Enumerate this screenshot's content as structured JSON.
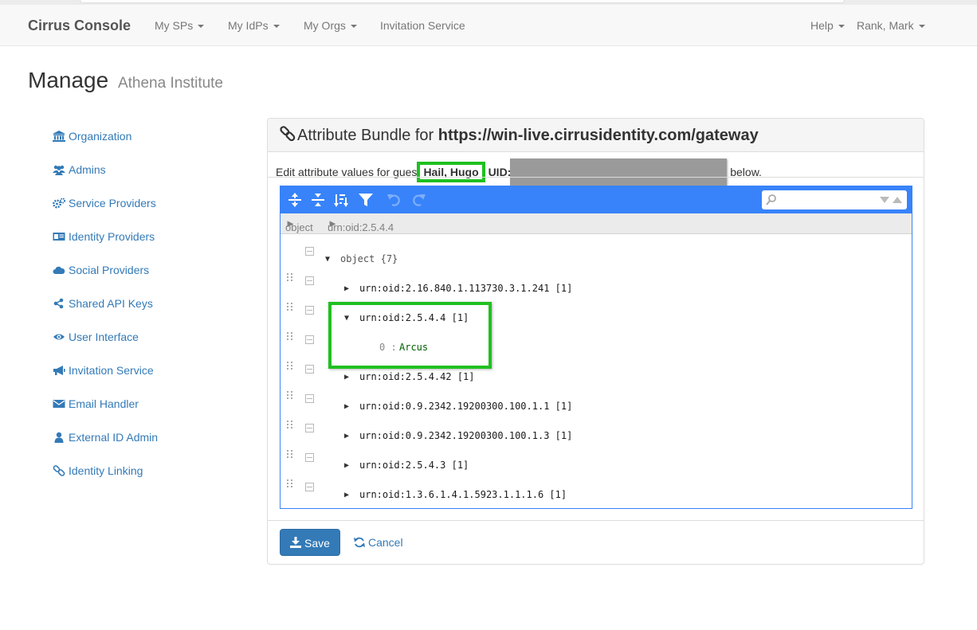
{
  "navbar": {
    "brand": "Cirrus Console",
    "items": [
      {
        "label": "My SPs",
        "dropdown": true
      },
      {
        "label": "My IdPs",
        "dropdown": true
      },
      {
        "label": "My Orgs",
        "dropdown": true
      },
      {
        "label": "Invitation Service",
        "dropdown": false
      }
    ],
    "right": [
      {
        "label": "Help",
        "dropdown": true
      },
      {
        "label": "Rank, Mark",
        "dropdown": true
      }
    ]
  },
  "page": {
    "title": "Manage",
    "subtitle": "Athena Institute"
  },
  "sidebar": {
    "items": [
      {
        "label": "Organization",
        "icon": "bank-icon"
      },
      {
        "label": "Admins",
        "icon": "users-icon"
      },
      {
        "label": "Service Providers",
        "icon": "cogs-icon"
      },
      {
        "label": "Identity Providers",
        "icon": "id-card-icon"
      },
      {
        "label": "Social Providers",
        "icon": "cloud-icon"
      },
      {
        "label": "Shared API Keys",
        "icon": "share-icon"
      },
      {
        "label": "User Interface",
        "icon": "eye-icon"
      },
      {
        "label": "Invitation Service",
        "icon": "bullhorn-icon"
      },
      {
        "label": "Email Handler",
        "icon": "envelope-icon"
      },
      {
        "label": "External ID Admin",
        "icon": "user-icon"
      },
      {
        "label": "Identity Linking",
        "icon": "link-icon"
      }
    ]
  },
  "panel": {
    "title_prefix": "Attribute Bundle for ",
    "title_url": "https://win-live.cirrusidentity.com/gateway",
    "instructions_prefix": "Edit attribute values for gues",
    "guest_name": "Hail, Hugo",
    "uid_label": "UID:",
    "instructions_suffix": "below.",
    "save_label": "Save",
    "cancel_label": "Cancel"
  },
  "editor": {
    "breadcrumb": [
      "object",
      "urn:oid:2.5.4.4"
    ],
    "search": {
      "placeholder": "",
      "value": ""
    },
    "menu_icons": [
      "expand-all-icon",
      "collapse-all-icon",
      "sort-icon",
      "filter-icon",
      "undo-icon",
      "redo-icon"
    ],
    "root": {
      "label": "object",
      "count": "{7}"
    },
    "nodes": [
      {
        "key": "urn:oid:2.16.840.1.113730.3.1.241",
        "count": "[1]",
        "expanded": false
      },
      {
        "key": "urn:oid:2.5.4.4",
        "count": "[1]",
        "expanded": true,
        "child_index": "0",
        "child_sep": ":",
        "child_value": "Arcus"
      },
      {
        "key": "urn:oid:2.5.4.42",
        "count": "[1]",
        "expanded": false
      },
      {
        "key": "urn:oid:0.9.2342.19200300.100.1.1",
        "count": "[1]",
        "expanded": false
      },
      {
        "key": "urn:oid:0.9.2342.19200300.100.1.3",
        "count": "[1]",
        "expanded": false
      },
      {
        "key": "urn:oid:2.5.4.3",
        "count": "[1]",
        "expanded": false
      },
      {
        "key": "urn:oid:1.3.6.1.4.1.5923.1.1.1.6",
        "count": "[1]",
        "expanded": false
      }
    ]
  },
  "colors": {
    "primary": "#337ab7",
    "editor_accent": "#3883fa",
    "highlight": "#20c020",
    "string_value": "#006000"
  }
}
